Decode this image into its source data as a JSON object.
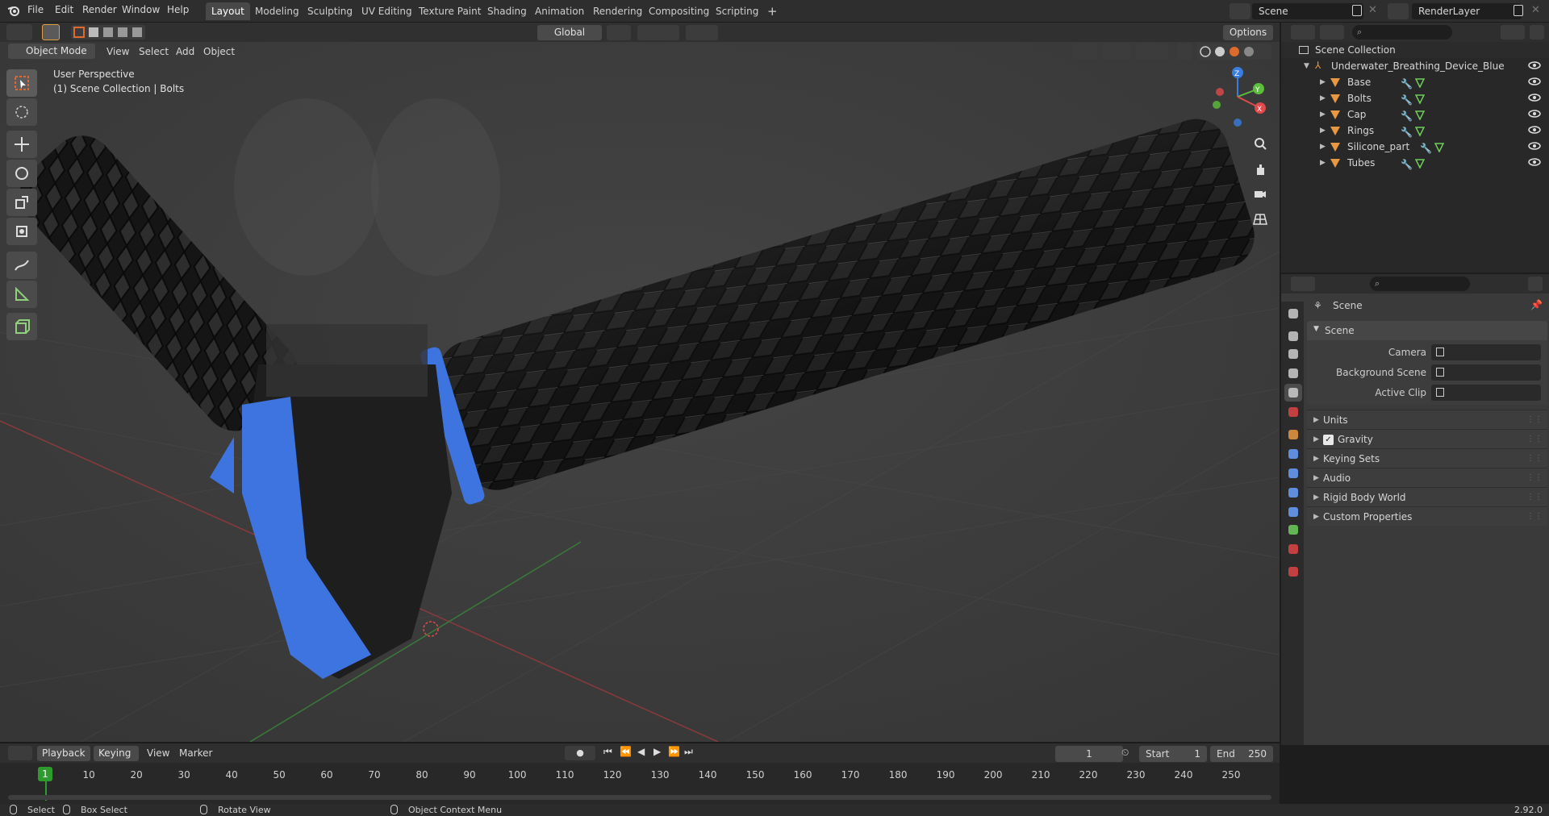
{
  "topbar": {
    "menus": [
      "File",
      "Edit",
      "Render",
      "Window",
      "Help"
    ],
    "workspace_tabs": [
      "Layout",
      "Modeling",
      "Sculpting",
      "UV Editing",
      "Texture Paint",
      "Shading",
      "Animation",
      "Rendering",
      "Compositing",
      "Scripting"
    ],
    "active_tab": "Layout",
    "add_tab_label": "+",
    "scene_name": "Scene",
    "render_layer": "RenderLayer"
  },
  "viewport_header": {
    "mode": "Object Mode",
    "menus": [
      "View",
      "Select",
      "Add",
      "Object"
    ],
    "orientation": "Global",
    "options_label": "Options"
  },
  "viewport": {
    "perspective_label": "User Perspective",
    "collection_label": "(1) Scene Collection | Bolts",
    "gizmo_axes": {
      "x": "X",
      "y": "Y",
      "z": "Z"
    }
  },
  "outliner": {
    "root": "Scene Collection",
    "collection": "Underwater_Breathing_Device_Blue",
    "objects": [
      "Base",
      "Bolts",
      "Cap",
      "Rings",
      "Silicone_part",
      "Tubes"
    ]
  },
  "properties": {
    "header_title": "Scene",
    "panel_title": "Scene",
    "fields": [
      {
        "label": "Camera"
      },
      {
        "label": "Background Scene"
      },
      {
        "label": "Active Clip"
      }
    ],
    "subpanels": [
      "Units",
      "Gravity",
      "Keying Sets",
      "Audio",
      "Rigid Body World",
      "Custom Properties"
    ],
    "gravity_checked": true
  },
  "timeline": {
    "menus": [
      "Playback",
      "Keying",
      "View",
      "Marker"
    ],
    "current_frame": "1",
    "start_label": "Start",
    "start_value": "1",
    "end_label": "End",
    "end_value": "250",
    "ticks": [
      "1",
      "10",
      "20",
      "30",
      "40",
      "50",
      "60",
      "70",
      "80",
      "90",
      "100",
      "110",
      "120",
      "130",
      "140",
      "150",
      "160",
      "170",
      "180",
      "190",
      "200",
      "210",
      "220",
      "230",
      "240",
      "250"
    ]
  },
  "statusbar": {
    "select": "Select",
    "box_select": "Box Select",
    "rotate_view": "Rotate View",
    "context_menu": "Object Context Menu",
    "version": "2.92.0"
  },
  "colors": {
    "accent_blue": "#3d74e0",
    "active_orange": "#e06a2c",
    "frame_green": "#2e9b2e",
    "x_axis_red": "#e04a4a",
    "y_axis_green": "#5cbf3c",
    "z_axis_blue": "#3a7de0"
  }
}
